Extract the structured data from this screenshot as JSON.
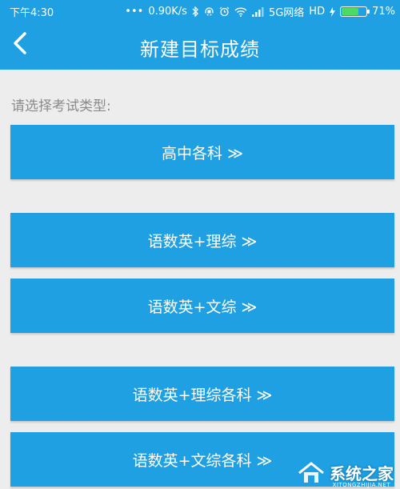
{
  "status_bar": {
    "time": "下午4:30",
    "dots": "•••",
    "speed": "0.90K/s",
    "network": "5G网络",
    "hd": "HD",
    "battery_text": "71%",
    "battery_level": 0.71
  },
  "header": {
    "title": "新建目标成绩",
    "back_glyph": "<"
  },
  "section": {
    "label": "请选择考试类型:"
  },
  "options": [
    {
      "label": "高中各科 ≫"
    },
    {
      "label": "语数英+理综 ≫"
    },
    {
      "label": "语数英+文综 ≫"
    },
    {
      "label": "语数英+理综各科 ≫"
    },
    {
      "label": "语数英+文综各科 ≫"
    }
  ],
  "watermark": {
    "text": "系统之家",
    "sub": "XITONGZHIJIA.NET"
  },
  "colors": {
    "accent": "#1ea0e2",
    "background": "#ededed",
    "label_gray": "#8a8a8a",
    "battery_green": "#4cd964"
  },
  "icons": {
    "back": "chevron-left-icon",
    "bluetooth": "bluetooth-icon",
    "alarm": "alarm-icon",
    "wifi": "wifi-icon",
    "signal": "signal-icon",
    "charging": "charging-icon",
    "battery": "battery-icon",
    "logo": "house-logo-icon"
  }
}
